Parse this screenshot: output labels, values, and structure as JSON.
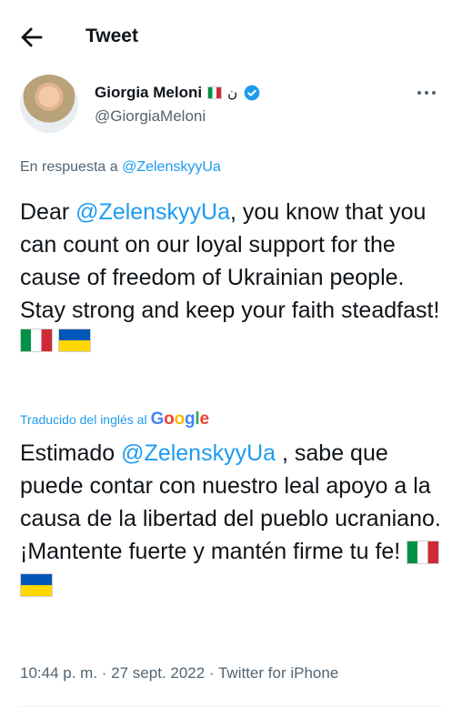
{
  "header": {
    "title": "Tweet",
    "back_icon": "back-arrow-icon"
  },
  "author": {
    "name": "Giorgia Meloni",
    "arabic_char": "ن",
    "handle": "@GiorgiaMeloni",
    "verified_color": "#1d9bf0"
  },
  "reply": {
    "prefix": "En respuesta a ",
    "mention": "@ZelenskyyUa"
  },
  "tweet": {
    "pre": "Dear ",
    "mention": "@ZelenskyyUa",
    "post": ", you know that you can count on our loyal support for the cause of freedom of Ukrainian people. Stay strong and keep your faith steadfast!"
  },
  "translation": {
    "label": "Traducido del inglés al",
    "brand": "Google",
    "pre": "Estimado ",
    "mention": "@ZelenskyyUa",
    "post": " , sabe que puede contar con nuestro leal apoyo a la causa de la libertad del pueblo ucraniano. ¡Mantente fuerte y mantén firme tu fe! "
  },
  "meta": {
    "text": "10:44 p. m. · 27 sept. 2022 · Twitter for iPhone"
  },
  "colors": {
    "accent": "#1d9bf0",
    "muted": "#536471",
    "text": "#0f1419"
  }
}
